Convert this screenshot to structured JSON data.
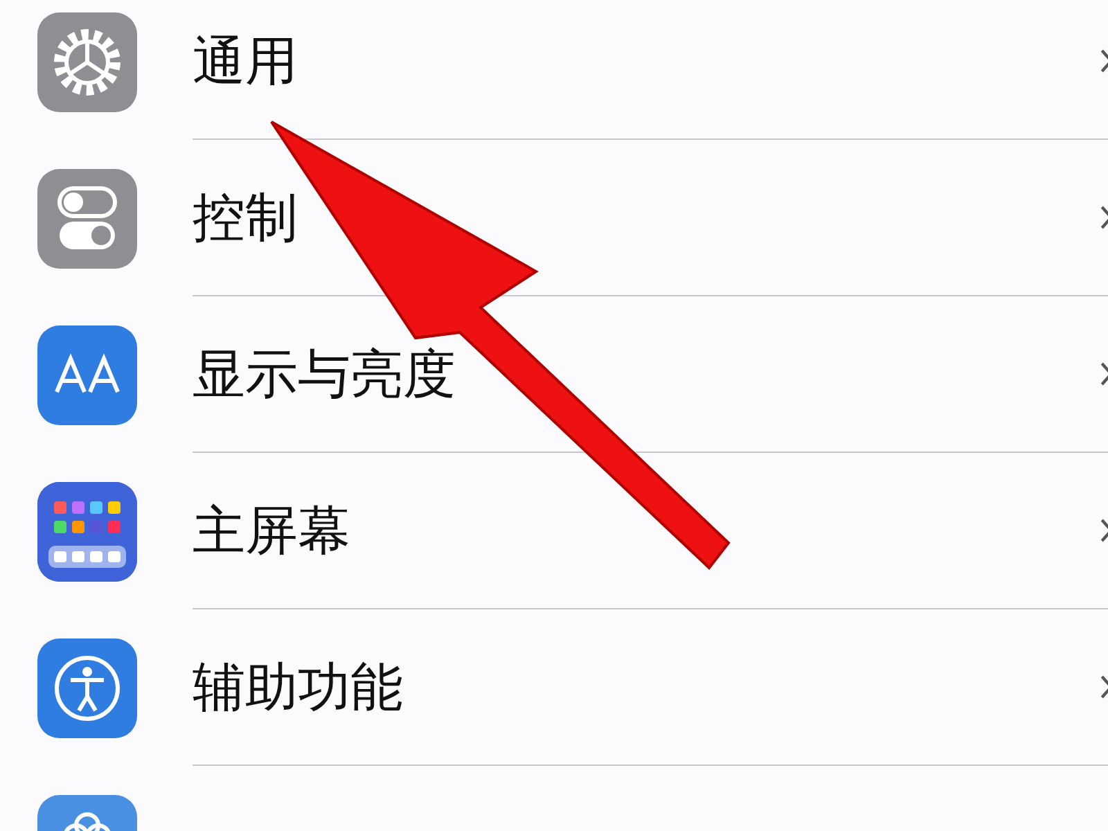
{
  "settings_rows": [
    {
      "label": "通用"
    },
    {
      "label": "控制"
    },
    {
      "label": "显示与亮度"
    },
    {
      "label": "主屏幕"
    },
    {
      "label": "辅助功能"
    },
    {}
  ],
  "annotation": {
    "kind": "arrow"
  }
}
